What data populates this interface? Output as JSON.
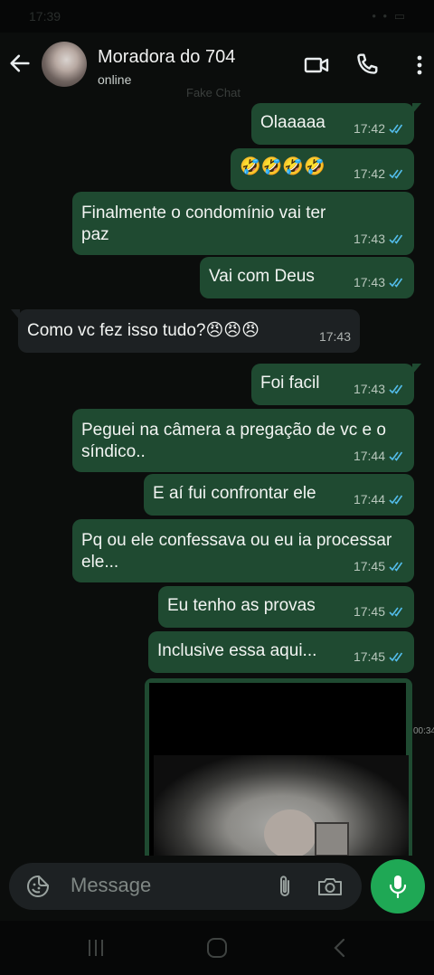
{
  "status_bar": {
    "time": "17:39",
    "system": "• • ▭"
  },
  "header": {
    "contact_name": "Moradora do 704",
    "status": "online",
    "watermark": "Fake Chat"
  },
  "messages": [
    {
      "direction": "out",
      "text": "Olaaaaa",
      "time": "17:42",
      "read": true
    },
    {
      "direction": "out",
      "text": "🤣🤣🤣🤣",
      "time": "17:42",
      "read": true
    },
    {
      "direction": "out",
      "text": "Finalmente o condomínio vai ter\npaz",
      "time": "17:43",
      "read": true
    },
    {
      "direction": "out",
      "text": "Vai com Deus",
      "time": "17:43",
      "read": true
    },
    {
      "direction": "in",
      "text": "Como vc fez isso tudo?😠😠😠",
      "time": "17:43"
    },
    {
      "direction": "out",
      "text": "Foi facil",
      "time": "17:43",
      "read": true
    },
    {
      "direction": "out",
      "text": "Peguei na câmera a pregação de vc e o\nsíndico..",
      "time": "17:44",
      "read": true
    },
    {
      "direction": "out",
      "text": "E aí fui confrontar ele",
      "time": "17:44",
      "read": true
    },
    {
      "direction": "out",
      "text": "Pq ou ele confessava ou eu ia processar\nele...",
      "time": "17:45",
      "read": true
    },
    {
      "direction": "out",
      "text": "Eu tenho as provas",
      "time": "17:45",
      "read": true
    },
    {
      "direction": "out",
      "text": "Inclusive essa aqui...",
      "time": "17:45",
      "read": true
    }
  ],
  "media": {
    "duration": "00:34"
  },
  "composer": {
    "placeholder": "Message"
  },
  "colors": {
    "outgoing_bubble": "#1f4a31",
    "incoming_bubble": "#1d2123",
    "read_ticks": "#53bdeb",
    "mic_button": "#1fa855"
  }
}
